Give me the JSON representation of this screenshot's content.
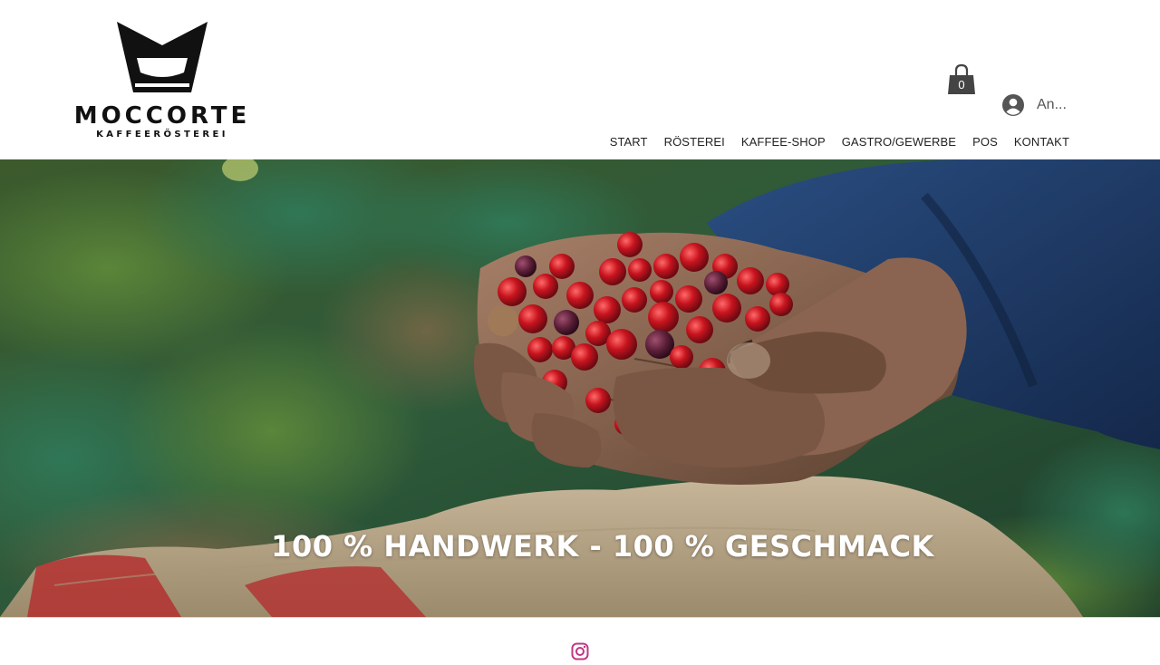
{
  "brand": {
    "name": "MOCCORTE",
    "tagline": "KAFFEERÖSTEREI"
  },
  "cart": {
    "count": "0"
  },
  "login": {
    "label": "An..."
  },
  "nav": {
    "items": [
      {
        "label": "START"
      },
      {
        "label": "RÖSTEREI"
      },
      {
        "label": "KAFFEE-SHOP"
      },
      {
        "label": "GASTRO/GEWERBE"
      },
      {
        "label": "POS"
      },
      {
        "label": "KONTAKT"
      }
    ]
  },
  "hero": {
    "title": "100 % HANDWERK - 100 % GESCHMACK"
  },
  "icons": {
    "cart": "shopping-bag-icon",
    "login": "user-avatar-icon",
    "social": "instagram-icon"
  },
  "colors": {
    "instagram": "#c13584"
  }
}
